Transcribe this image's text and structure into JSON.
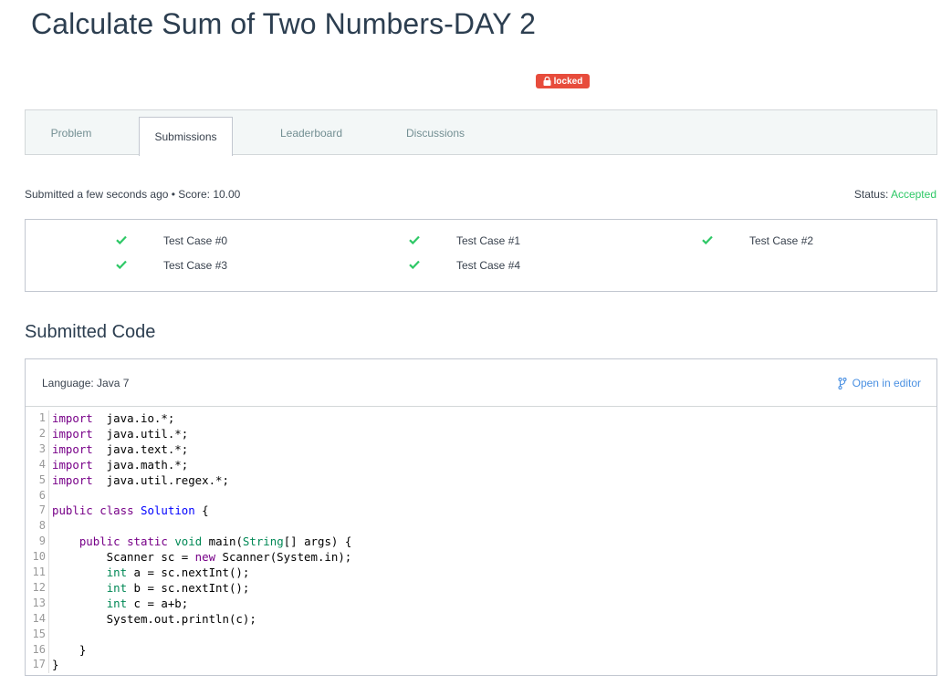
{
  "page": {
    "title": "Calculate Sum of Two Numbers-DAY 2",
    "locked_badge": "locked"
  },
  "tabs": [
    {
      "label": "Problem",
      "active": false
    },
    {
      "label": "Submissions",
      "active": true
    },
    {
      "label": "Leaderboard",
      "active": false
    },
    {
      "label": "Discussions",
      "active": false
    }
  ],
  "submission": {
    "submitted_text": "Submitted a few seconds ago • Score: 10.00",
    "status_label": "Status:",
    "status_value": "Accepted"
  },
  "test_cases": [
    {
      "label": "Test Case #0",
      "passed": true
    },
    {
      "label": "Test Case #1",
      "passed": true
    },
    {
      "label": "Test Case #2",
      "passed": true
    },
    {
      "label": "Test Case #3",
      "passed": true
    },
    {
      "label": "Test Case #4",
      "passed": true
    }
  ],
  "code_section": {
    "title": "Submitted Code",
    "language": "Language: Java 7",
    "open_in_editor": "Open in editor",
    "lines": [
      {
        "n": "1",
        "tokens": [
          [
            "kw",
            "import"
          ],
          [
            "",
            "  java.io.*;"
          ]
        ]
      },
      {
        "n": "2",
        "tokens": [
          [
            "kw",
            "import"
          ],
          [
            "",
            "  java.util.*;"
          ]
        ]
      },
      {
        "n": "3",
        "tokens": [
          [
            "kw",
            "import"
          ],
          [
            "",
            "  java.text.*;"
          ]
        ]
      },
      {
        "n": "4",
        "tokens": [
          [
            "kw",
            "import"
          ],
          [
            "",
            "  java.math.*;"
          ]
        ]
      },
      {
        "n": "5",
        "tokens": [
          [
            "kw",
            "import"
          ],
          [
            "",
            "  java.util.regex.*;"
          ]
        ]
      },
      {
        "n": "6",
        "tokens": []
      },
      {
        "n": "7",
        "tokens": [
          [
            "kw",
            "public"
          ],
          [
            "",
            " "
          ],
          [
            "kw",
            "class"
          ],
          [
            "",
            " "
          ],
          [
            "def",
            "Solution"
          ],
          [
            "",
            " {"
          ]
        ]
      },
      {
        "n": "8",
        "tokens": []
      },
      {
        "n": "9",
        "tokens": [
          [
            "",
            "    "
          ],
          [
            "kw",
            "public"
          ],
          [
            "",
            " "
          ],
          [
            "kw",
            "static"
          ],
          [
            "",
            " "
          ],
          [
            "ty",
            "void"
          ],
          [
            "",
            " main("
          ],
          [
            "ty",
            "String"
          ],
          [
            "",
            "[] args) {"
          ]
        ]
      },
      {
        "n": "10",
        "tokens": [
          [
            "",
            "        Scanner sc = "
          ],
          [
            "kw",
            "new"
          ],
          [
            "",
            " Scanner(System.in);"
          ]
        ]
      },
      {
        "n": "11",
        "tokens": [
          [
            "",
            "        "
          ],
          [
            "ty",
            "int"
          ],
          [
            "",
            " a = sc.nextInt();"
          ]
        ]
      },
      {
        "n": "12",
        "tokens": [
          [
            "",
            "        "
          ],
          [
            "ty",
            "int"
          ],
          [
            "",
            " b = sc.nextInt();"
          ]
        ]
      },
      {
        "n": "13",
        "tokens": [
          [
            "",
            "        "
          ],
          [
            "ty",
            "int"
          ],
          [
            "",
            " c = a+b;"
          ]
        ]
      },
      {
        "n": "14",
        "tokens": [
          [
            "",
            "        System.out.println(c);"
          ]
        ]
      },
      {
        "n": "15",
        "tokens": []
      },
      {
        "n": "16",
        "tokens": [
          [
            "",
            "    }"
          ]
        ]
      },
      {
        "n": "17",
        "tokens": [
          [
            "",
            "}"
          ]
        ]
      }
    ]
  },
  "colors": {
    "accepted": "#2ec866",
    "locked_badge": "#e74c3c",
    "link": "#4a90e2",
    "check": "#2ec866"
  },
  "icons": {
    "lock": "lock-icon",
    "check": "check-icon",
    "branch": "branch-icon"
  }
}
